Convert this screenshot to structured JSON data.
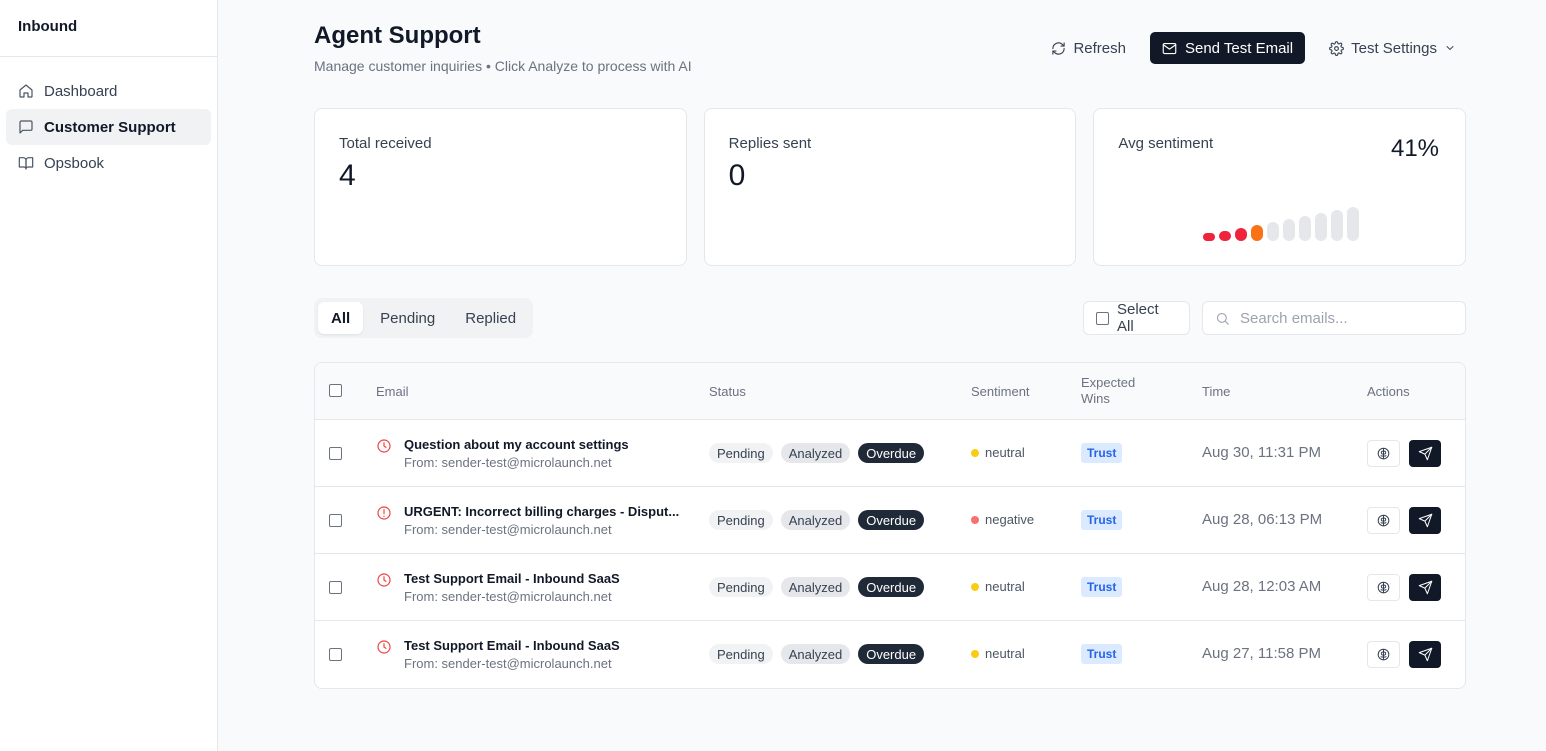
{
  "app": {
    "brand": "Inbound"
  },
  "sidebar": {
    "items": [
      {
        "label": "Dashboard",
        "icon": "home-icon",
        "active": false
      },
      {
        "label": "Customer Support",
        "icon": "message-square-icon",
        "active": true
      },
      {
        "label": "Opsbook",
        "icon": "book-open-icon",
        "active": false
      }
    ]
  },
  "header": {
    "title": "Agent Support",
    "subtitle": "Manage customer inquiries • Click Analyze to process with AI",
    "refresh_label": "Refresh",
    "send_test_label": "Send Test Email",
    "test_settings_label": "Test Settings"
  },
  "stats": {
    "total_received_label": "Total received",
    "total_received": "4",
    "replies_sent_label": "Replies sent",
    "replies_sent": "0",
    "avg_sentiment_label": "Avg sentiment",
    "avg_sentiment": "41%",
    "sentiment_level": 0.41,
    "sentiment_colors": {
      "low": "#ef233c",
      "active": "#f97316",
      "inactive": "#e5e7eb"
    }
  },
  "filters": {
    "tabs": [
      "All",
      "Pending",
      "Replied"
    ],
    "active_tab": "All",
    "select_all_label": "Select All",
    "search_placeholder": "Search emails..."
  },
  "table": {
    "headers": {
      "email": "Email",
      "status": "Status",
      "sentiment": "Sentiment",
      "expected_wins": "Expected Wins",
      "time": "Time",
      "actions": "Actions"
    },
    "rows": [
      {
        "icon": "clock-icon",
        "subject": "Question about my account settings",
        "from": "From: sender-test@microlaunch.net",
        "statuses": [
          "Pending",
          "Analyzed",
          "Overdue"
        ],
        "sentiment": "neutral",
        "sentiment_color": "#facc15",
        "win": "Trust",
        "time": "Aug 30, 11:31 PM"
      },
      {
        "icon": "alert-circle-icon",
        "subject": "URGENT: Incorrect billing charges - Disput...",
        "from": "From: sender-test@microlaunch.net",
        "statuses": [
          "Pending",
          "Analyzed",
          "Overdue"
        ],
        "sentiment": "negative",
        "sentiment_color": "#f87171",
        "win": "Trust",
        "time": "Aug 28, 06:13 PM"
      },
      {
        "icon": "clock-icon",
        "subject": "Test Support Email - Inbound SaaS",
        "from": "From: sender-test@microlaunch.net",
        "statuses": [
          "Pending",
          "Analyzed",
          "Overdue"
        ],
        "sentiment": "neutral",
        "sentiment_color": "#facc15",
        "win": "Trust",
        "time": "Aug 28, 12:03 AM"
      },
      {
        "icon": "clock-icon",
        "subject": "Test Support Email - Inbound SaaS",
        "from": "From: sender-test@microlaunch.net",
        "statuses": [
          "Pending",
          "Analyzed",
          "Overdue"
        ],
        "sentiment": "neutral",
        "sentiment_color": "#facc15",
        "win": "Trust",
        "time": "Aug 27, 11:58 PM"
      }
    ]
  }
}
